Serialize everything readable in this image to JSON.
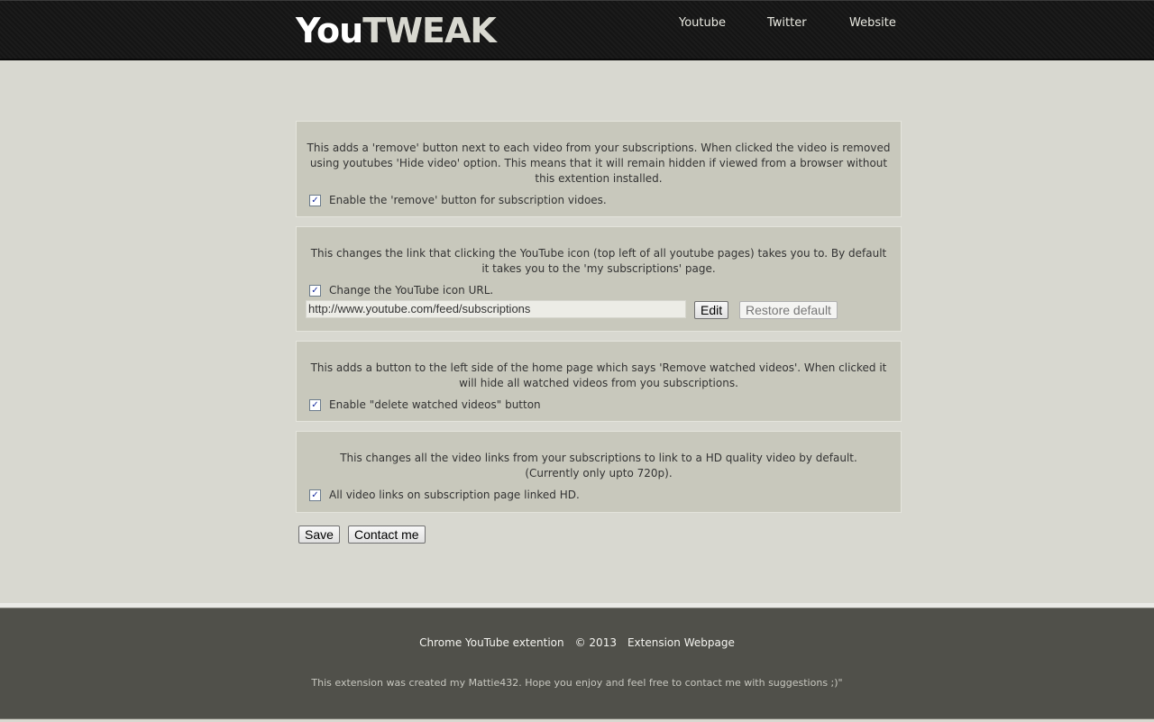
{
  "header": {
    "logo_part1": "You",
    "logo_part2": "TWEAK",
    "nav": [
      "Youtube",
      "Twitter",
      "Website"
    ]
  },
  "sections": [
    {
      "description": "This adds a 'remove' button next to each video from your subscriptions. When clicked the video is removed using youtubes 'Hide video' option. This means that it will remain hidden if viewed from a browser without this extention installed.",
      "checkbox_label": "Enable the 'remove' button for subscription vidoes.",
      "checked": true
    },
    {
      "description": "This changes the link that clicking the YouTube icon (top left of all youtube pages) takes you to. By default it takes you to the 'my subscriptions' page.",
      "checkbox_label": "Change the YouTube icon URL.",
      "checked": true,
      "url_value": "http://www.youtube.com/feed/subscriptions",
      "edit_label": "Edit",
      "restore_label": "Restore default"
    },
    {
      "description": "This adds a button to the left side of the home page which says 'Remove watched videos'. When clicked it will hide all watched videos from you subscriptions.",
      "checkbox_label": "Enable \"delete watched videos\" button",
      "checked": true
    },
    {
      "description": "This changes all the video links from your subscriptions to link to a HD quality video by default. (Currently only upto 720p).",
      "checkbox_label": "All video links on subscription page linked HD.",
      "checked": true
    }
  ],
  "actions": {
    "save_label": "Save",
    "contact_label": "Contact me"
  },
  "footer": {
    "app_name": "Chrome YouTube extention",
    "copyright": "© 2013",
    "webpage_link": "Extension Webpage",
    "note": "This extension was created my Mattie432. Hope you enjoy and feel free to contact me with suggestions ;)\""
  },
  "icons": {
    "checkbox_checked": "✓"
  }
}
